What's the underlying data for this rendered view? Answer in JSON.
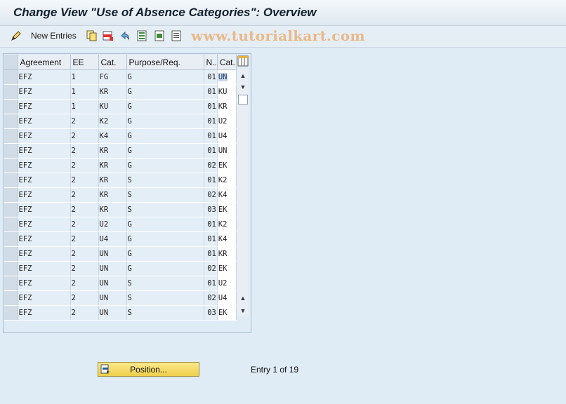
{
  "window": {
    "title": "Change View \"Use of Absence Categories\": Overview"
  },
  "toolbar": {
    "new_entries_label": "New Entries",
    "icons": [
      "edit-pen-icon",
      "copy-icon",
      "delete-icon",
      "undo-icon",
      "select-all-icon",
      "select-block-icon",
      "deselect-all-icon"
    ]
  },
  "watermark": "www.tutorialkart.com",
  "table": {
    "headers": [
      "Agreement",
      "EE",
      "Cat.",
      "Purpose/Req.",
      "N..",
      "Cat."
    ],
    "rows": [
      [
        "EFZ",
        "1",
        "FG",
        "G",
        "01",
        "UN"
      ],
      [
        "EFZ",
        "1",
        "KR",
        "G",
        "01",
        "KU"
      ],
      [
        "EFZ",
        "1",
        "KU",
        "G",
        "01",
        "KR"
      ],
      [
        "EFZ",
        "2",
        "K2",
        "G",
        "01",
        "U2"
      ],
      [
        "EFZ",
        "2",
        "K4",
        "G",
        "01",
        "U4"
      ],
      [
        "EFZ",
        "2",
        "KR",
        "G",
        "01",
        "UN"
      ],
      [
        "EFZ",
        "2",
        "KR",
        "G",
        "02",
        "EK"
      ],
      [
        "EFZ",
        "2",
        "KR",
        "S",
        "01",
        "K2"
      ],
      [
        "EFZ",
        "2",
        "KR",
        "S",
        "02",
        "K4"
      ],
      [
        "EFZ",
        "2",
        "KR",
        "S",
        "03",
        "EK"
      ],
      [
        "EFZ",
        "2",
        "U2",
        "G",
        "01",
        "K2"
      ],
      [
        "EFZ",
        "2",
        "U4",
        "G",
        "01",
        "K4"
      ],
      [
        "EFZ",
        "2",
        "UN",
        "G",
        "01",
        "KR"
      ],
      [
        "EFZ",
        "2",
        "UN",
        "G",
        "02",
        "EK"
      ],
      [
        "EFZ",
        "2",
        "UN",
        "S",
        "01",
        "U2"
      ],
      [
        "EFZ",
        "2",
        "UN",
        "S",
        "02",
        "U4"
      ],
      [
        "EFZ",
        "2",
        "UN",
        "S",
        "03",
        "EK"
      ]
    ]
  },
  "footer": {
    "position_label": "Position...",
    "entry_text": "Entry 1 of 19"
  }
}
